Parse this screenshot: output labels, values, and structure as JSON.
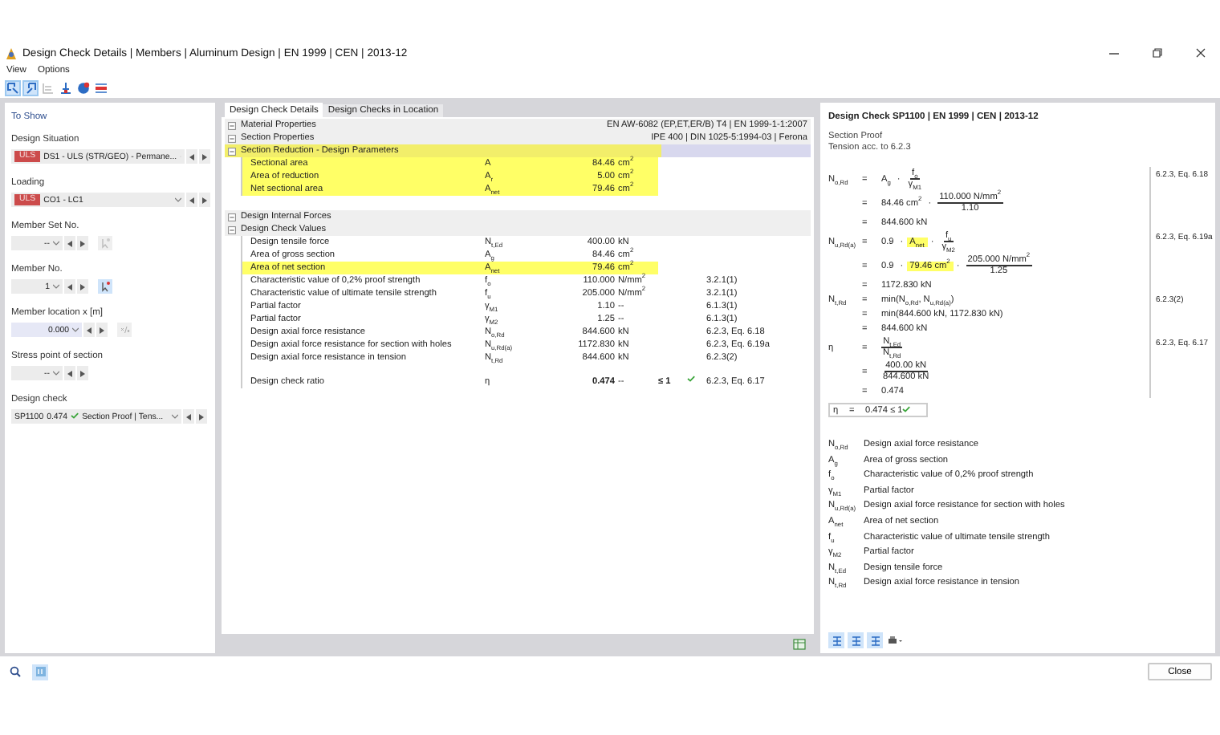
{
  "window": {
    "title": "Design Check Details | Members | Aluminum Design | EN 1999 | CEN | 2013-12"
  },
  "menu": [
    "View",
    "Options"
  ],
  "toolbar": [
    {
      "selected": true
    },
    {
      "selected": true
    },
    {
      "selected": false
    },
    {
      "selected": false
    },
    {
      "selected": false
    },
    {
      "selected": false
    }
  ],
  "to_show": {
    "title": "To Show",
    "fields": [
      {
        "kind": "combo",
        "label": "Design Situation",
        "badge": "ULS",
        "value": "DS1 - ULS (STR/GEO) - Permane..."
      },
      {
        "kind": "combo",
        "label": "Loading",
        "badge": "ULS",
        "value": "CO1 - LC1"
      },
      {
        "kind": "spin_pick",
        "label": "Member Set No.",
        "value": "--",
        "selected": false
      },
      {
        "kind": "spin_pick",
        "label": "Member No.",
        "value": "1",
        "selected": true
      },
      {
        "kind": "location",
        "label": "Member location x [m]",
        "value": "0.000"
      },
      {
        "kind": "spin",
        "label": "Stress point of section",
        "value": "--"
      },
      {
        "kind": "check",
        "label": "Design check",
        "check_id": "SP1100",
        "ratio": "0.474",
        "ok": true,
        "value": "Section Proof | Tens..."
      }
    ]
  },
  "tabs": [
    {
      "label": "Design Check Details",
      "selected": true
    },
    {
      "label": "Design Checks in Location",
      "selected": false
    }
  ],
  "sections": [
    {
      "title": "Material Properties",
      "info": "EN AW-6082 (EP,ET,ER/B) T4 | EN 1999-1-1:2007",
      "selected": false,
      "highlighted": false
    },
    {
      "title": "Section Properties",
      "info": "IPE 400 | DIN 1025-5:1994-03 | Ferona",
      "selected": false,
      "highlighted": false
    },
    {
      "title": "Section Reduction - Design Parameters",
      "selected": true,
      "highlighted": true,
      "rows": [
        {
          "kind": "value",
          "label": "Sectional area",
          "symbol": "A",
          "value": "84.46",
          "unit": "cm$^{2}$",
          "highlighted": true
        },
        {
          "kind": "value",
          "label": "Area of reduction",
          "symbol": "A$_{r}$",
          "value": "5.00",
          "unit": "cm$^{2}$",
          "highlighted": true
        },
        {
          "kind": "value",
          "label": "Net sectional area",
          "symbol": "A$_{net}$",
          "value": "79.46",
          "unit": "cm$^{2}$",
          "highlighted": true
        }
      ]
    },
    {
      "title": "Design Internal Forces",
      "selected": false,
      "highlighted": false
    },
    {
      "title": "Design Check Values",
      "selected": false,
      "highlighted": false,
      "rows": [
        {
          "kind": "value",
          "label": "Design tensile force",
          "symbol": "N$_{t,Ed}$",
          "value": "400.00",
          "unit": "kN",
          "highlighted": false
        },
        {
          "kind": "value",
          "label": "Area of gross section",
          "symbol": "A$_{g}$",
          "value": "84.46",
          "unit": "cm$^{2}$",
          "highlighted": false
        },
        {
          "kind": "value",
          "label": "Area of net section",
          "symbol": "A$_{net}$",
          "value": "79.46",
          "unit": "cm$^{2}$",
          "highlighted": true
        },
        {
          "kind": "value",
          "label": "Characteristic value of 0,2% proof strength",
          "symbol": "f$_{o}$",
          "value": "110.000",
          "unit": "N/mm$^{2}$",
          "reference": "3.2.1(1)",
          "highlighted": false
        },
        {
          "kind": "value",
          "label": "Characteristic value of ultimate tensile strength",
          "symbol": "f$_{u}$",
          "value": "205.000",
          "unit": "N/mm$^{2}$",
          "reference": "3.2.1(1)",
          "highlighted": false
        },
        {
          "kind": "value",
          "label": "Partial factor",
          "symbol": "γ$_{M1}$",
          "value": "1.10",
          "unit": "--",
          "reference": "6.1.3(1)",
          "highlighted": false
        },
        {
          "kind": "value",
          "label": "Partial factor",
          "symbol": "γ$_{M2}$",
          "value": "1.25",
          "unit": "--",
          "reference": "6.1.3(1)",
          "highlighted": false
        },
        {
          "kind": "value",
          "label": "Design axial force resistance",
          "symbol": "N$_{o,Rd}$",
          "value": "844.600",
          "unit": "kN",
          "reference": "6.2.3, Eq. 6.18",
          "highlighted": false
        },
        {
          "kind": "value",
          "label": "Design axial force resistance for section with holes",
          "symbol": "N$_{u,Rd(a)}$",
          "value": "1172.830",
          "unit": "kN",
          "reference": "6.2.3, Eq. 6.19a",
          "highlighted": false
        },
        {
          "kind": "value",
          "label": "Design axial force resistance in tension",
          "symbol": "N$_{t,Rd}$",
          "value": "844.600",
          "unit": "kN",
          "reference": "6.2.3(2)",
          "highlighted": false
        },
        {
          "kind": "blank"
        },
        {
          "kind": "ratio",
          "label": "Design check ratio",
          "symbol": "η",
          "value": "0.474",
          "unit": "--",
          "limit": "≤ 1",
          "ok": true,
          "reference": "6.2.3, Eq. 6.17",
          "highlighted": false
        }
      ]
    }
  ],
  "details": {
    "title": "Design Check SP1100 | EN 1999 | CEN | 2013-12",
    "intro": [
      "Section Proof",
      "Tension acc. to 6.2.3"
    ],
    "groups": [
      {
        "reference": "6.2.3, Eq. 6.18",
        "lines": [
          {
            "lhs": "N$_{o,Rd}$",
            "sign": "=",
            "terms": [
              {
                "kind": "text",
                "text": "A$_{g}$",
                "highlighted": false
              },
              {
                "kind": "op",
                "text": "·"
              },
              {
                "kind": "fraction",
                "numerator": "f$_{o}$",
                "denominator": "γ$_{M1}$"
              }
            ]
          },
          {
            "sign": "=",
            "terms": [
              {
                "kind": "text",
                "text": "84.46 cm$^{2}$",
                "highlighted": false
              },
              {
                "kind": "op",
                "text": "·"
              },
              {
                "kind": "fraction",
                "numerator": "110.000 N/mm$^{2}$",
                "denominator": "1.10"
              }
            ]
          },
          {
            "sign": "=",
            "terms": [
              {
                "kind": "text",
                "text": "844.600 kN",
                "highlighted": false
              }
            ]
          }
        ]
      },
      {
        "reference": "6.2.3, Eq. 6.19a",
        "lines": [
          {
            "lhs": "N$_{u,Rd(a)}$",
            "sign": "=",
            "terms": [
              {
                "kind": "text",
                "text": "0.9",
                "highlighted": false
              },
              {
                "kind": "op",
                "text": "·"
              },
              {
                "kind": "text",
                "text": "A$_{net}$",
                "highlighted": true
              },
              {
                "kind": "op",
                "text": "·"
              },
              {
                "kind": "fraction",
                "numerator": "f$_{u}$",
                "denominator": "γ$_{M2}$"
              }
            ]
          },
          {
            "sign": "=",
            "terms": [
              {
                "kind": "text",
                "text": "0.9",
                "highlighted": false
              },
              {
                "kind": "op",
                "text": "·"
              },
              {
                "kind": "text",
                "text": "79.46 cm$^{2}$",
                "highlighted": true
              },
              {
                "kind": "op",
                "text": "·"
              },
              {
                "kind": "fraction",
                "numerator": "205.000 N/mm$^{2}$",
                "denominator": "1.25"
              }
            ]
          },
          {
            "sign": "=",
            "terms": [
              {
                "kind": "text",
                "text": "1172.830 kN",
                "highlighted": false
              }
            ]
          }
        ]
      },
      {
        "reference": "6.2.3(2)",
        "lines": [
          {
            "lhs": "N$_{t,Rd}$",
            "sign": "=",
            "terms": [
              {
                "kind": "text",
                "text": "min(N$_{o,Rd}$, N$_{u,Rd(a)}$)",
                "highlighted": false
              }
            ]
          },
          {
            "sign": "=",
            "terms": [
              {
                "kind": "text",
                "text": "min(844.600 kN, 1172.830 kN)",
                "highlighted": false
              }
            ]
          },
          {
            "sign": "=",
            "terms": [
              {
                "kind": "text",
                "text": "844.600 kN",
                "highlighted": false
              }
            ]
          }
        ]
      },
      {
        "reference": "6.2.3, Eq. 6.17",
        "lines": [
          {
            "lhs": "η",
            "sign": "=",
            "terms": [
              {
                "kind": "fraction",
                "numerator": "N$_{t,Ed}$",
                "denominator": "N$_{t,Rd}$"
              }
            ]
          },
          {
            "sign": "=",
            "terms": [
              {
                "kind": "fraction",
                "numerator": "400.00 kN",
                "denominator": "844.600 kN"
              }
            ]
          },
          {
            "sign": "=",
            "terms": [
              {
                "kind": "text",
                "text": "0.474",
                "highlighted": false
              }
            ]
          }
        ]
      }
    ],
    "result": {
      "lhs": "η",
      "sign": "=",
      "value": "0.474",
      "limit": "≤ 1",
      "ok": true
    },
    "legend": [
      {
        "symbol": "N$_{o,Rd}$",
        "description": "Design axial force resistance"
      },
      {
        "symbol": "A$_{g}$",
        "description": "Area of gross section"
      },
      {
        "symbol": "f$_{o}$",
        "description": "Characteristic value of 0,2% proof strength"
      },
      {
        "symbol": "γ$_{M1}$",
        "description": "Partial factor"
      },
      {
        "symbol": "N$_{u,Rd(a)}$",
        "description": "Design axial force resistance for section with holes"
      },
      {
        "symbol": "A$_{net}$",
        "description": "Area of net section"
      },
      {
        "symbol": "f$_{u}$",
        "description": "Characteristic value of ultimate tensile strength"
      },
      {
        "symbol": "γ$_{M2}$",
        "description": "Partial factor"
      },
      {
        "symbol": "N$_{t,Ed}$",
        "description": "Design tensile force"
      },
      {
        "symbol": "N$_{t,Rd}$",
        "description": "Design axial force resistance in tension"
      }
    ],
    "toolbar": [
      {
        "selected": true
      },
      {
        "selected": true
      },
      {
        "selected": true
      },
      {
        "selected": false
      }
    ]
  },
  "buttons": [
    "Close"
  ]
}
